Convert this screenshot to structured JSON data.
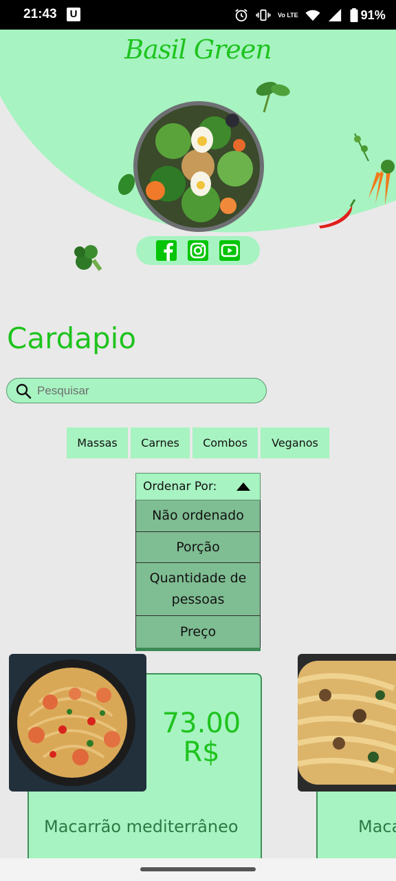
{
  "status_bar": {
    "time": "21:43",
    "app_badge": "U",
    "network_label": "Vo LTE",
    "battery": "91%",
    "icons": [
      "alarm-icon",
      "vibrate-icon",
      "volte-icon",
      "wifi-icon",
      "signal-icon",
      "battery-icon"
    ]
  },
  "header": {
    "brand": "Basil Green",
    "social": [
      "facebook-icon",
      "instagram-icon",
      "youtube-icon"
    ]
  },
  "colors": {
    "accent_green": "#1ec31e",
    "mint": "#a7f3c1",
    "option_green": "#7fbd92",
    "background": "#e9e9e9"
  },
  "main": {
    "title": "Cardapio",
    "search": {
      "placeholder": "Pesquisar",
      "value": ""
    },
    "categories": [
      "Massas",
      "Carnes",
      "Combos",
      "Veganos"
    ],
    "sort": {
      "label": "Ordenar Por:",
      "options": [
        "Não ordenado",
        "Porção",
        "Quantidade de pessoas",
        "Preço"
      ]
    },
    "products": [
      {
        "price": "73.00",
        "currency": "R$",
        "name": "Macarrão mediterrâneo"
      },
      {
        "price": "",
        "currency": "",
        "name": "Maca"
      }
    ]
  }
}
